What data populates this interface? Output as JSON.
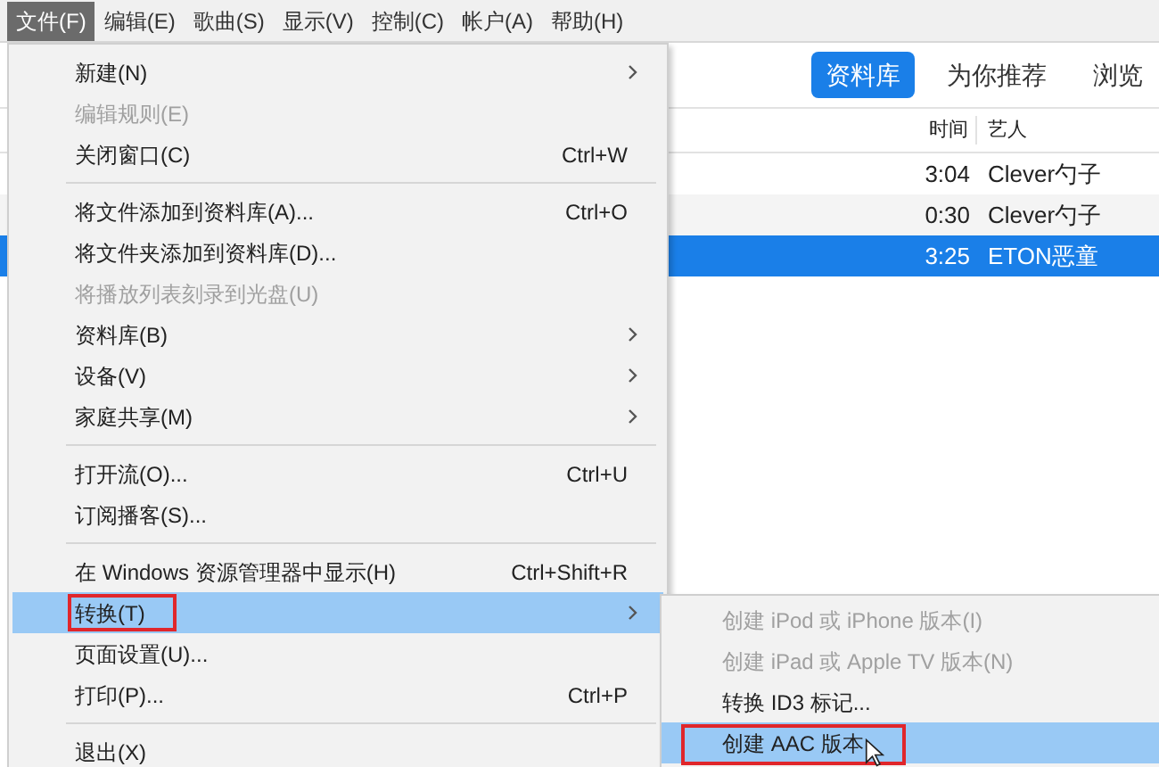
{
  "menu_bar": [
    {
      "label": "文件(F)",
      "selected": true
    },
    {
      "label": "编辑(E)",
      "selected": false
    },
    {
      "label": "歌曲(S)",
      "selected": false
    },
    {
      "label": "显示(V)",
      "selected": false
    },
    {
      "label": "控制(C)",
      "selected": false
    },
    {
      "label": "帐户(A)",
      "selected": false
    },
    {
      "label": "帮助(H)",
      "selected": false
    }
  ],
  "tabs": [
    {
      "label": "资料库",
      "selected": true
    },
    {
      "label": "为你推荐",
      "selected": false
    },
    {
      "label": "浏览",
      "selected": false
    }
  ],
  "table": {
    "columns": [
      "时间",
      "艺人"
    ],
    "rows": [
      {
        "time": "3:04",
        "artist": "Clever勺子",
        "selected": false
      },
      {
        "time": "0:30",
        "artist": "Clever勺子",
        "selected": false
      },
      {
        "time": "3:25",
        "artist": "ETON恶童",
        "selected": true
      }
    ]
  },
  "file_menu": [
    {
      "kind": "item",
      "label": "新建(N)",
      "submenu": true,
      "disabled": false,
      "selected": false
    },
    {
      "kind": "item",
      "label": "编辑规则(E)",
      "disabled": true,
      "selected": false
    },
    {
      "kind": "item",
      "label": "关闭窗口(C)",
      "shortcut": "Ctrl+W",
      "disabled": false,
      "selected": false
    },
    {
      "kind": "separator"
    },
    {
      "kind": "item",
      "label": "将文件添加到资料库(A)...",
      "shortcut": "Ctrl+O",
      "disabled": false,
      "selected": false
    },
    {
      "kind": "item",
      "label": "将文件夹添加到资料库(D)...",
      "disabled": false,
      "selected": false
    },
    {
      "kind": "item",
      "label": "将播放列表刻录到光盘(U)",
      "disabled": true,
      "selected": false
    },
    {
      "kind": "item",
      "label": "资料库(B)",
      "submenu": true,
      "disabled": false,
      "selected": false
    },
    {
      "kind": "item",
      "label": "设备(V)",
      "submenu": true,
      "disabled": false,
      "selected": false
    },
    {
      "kind": "item",
      "label": "家庭共享(M)",
      "submenu": true,
      "disabled": false,
      "selected": false
    },
    {
      "kind": "separator"
    },
    {
      "kind": "item",
      "label": "打开流(O)...",
      "shortcut": "Ctrl+U",
      "disabled": false,
      "selected": false
    },
    {
      "kind": "item",
      "label": "订阅播客(S)...",
      "disabled": false,
      "selected": false
    },
    {
      "kind": "separator"
    },
    {
      "kind": "item",
      "label": "在 Windows 资源管理器中显示(H)",
      "shortcut": "Ctrl+Shift+R",
      "disabled": false,
      "selected": false
    },
    {
      "kind": "item",
      "label": "转换(T)",
      "submenu": true,
      "disabled": false,
      "selected": true,
      "annotated": true
    },
    {
      "kind": "item",
      "label": "页面设置(U)...",
      "disabled": false,
      "selected": false
    },
    {
      "kind": "item",
      "label": "打印(P)...",
      "shortcut": "Ctrl+P",
      "disabled": false,
      "selected": false
    },
    {
      "kind": "separator"
    },
    {
      "kind": "item",
      "label": "退出(X)",
      "disabled": false,
      "selected": false
    }
  ],
  "convert_submenu": [
    {
      "label": "创建 iPod 或 iPhone 版本(I)",
      "disabled": true,
      "selected": false
    },
    {
      "label": "创建 iPad 或 Apple TV 版本(N)",
      "disabled": true,
      "selected": false
    },
    {
      "label": "转换 ID3 标记...",
      "disabled": false,
      "selected": false
    },
    {
      "label": "创建 AAC 版本",
      "disabled": false,
      "selected": true,
      "annotated": true
    }
  ]
}
